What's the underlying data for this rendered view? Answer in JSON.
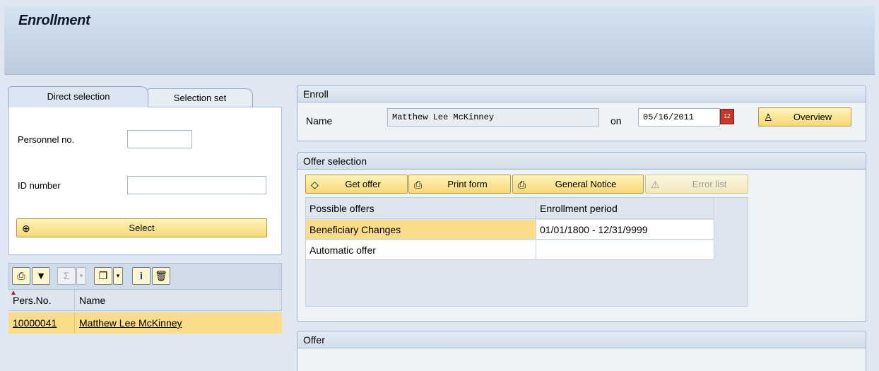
{
  "window": {
    "title": "Enrollment"
  },
  "left": {
    "tabs": [
      {
        "label": "Direct selection",
        "active": true
      },
      {
        "label": "Selection set",
        "active": false
      }
    ],
    "personnel_no": {
      "label": "Personnel no.",
      "value": ""
    },
    "id_number": {
      "label": "ID number",
      "value": ""
    },
    "select_button": "Select",
    "alv_toolbar_icons": [
      "print-icon",
      "filter-icon",
      "sum-icon",
      "dropdown-icon",
      "layout-icon",
      "dropdown-icon",
      "info-icon",
      "delete-icon"
    ],
    "results": {
      "columns": [
        "Pers.No.",
        "Name"
      ],
      "rows": [
        {
          "pers_no": "10000041",
          "name": "Matthew Lee McKinney"
        }
      ]
    }
  },
  "enroll": {
    "title": "Enroll",
    "name_label": "Name",
    "name_value": "Matthew Lee McKinney",
    "on_label": "on",
    "date_value": "05/16/2011",
    "overview_button": "Overview"
  },
  "offer_selection": {
    "title": "Offer selection",
    "buttons": {
      "get_offer": "Get offer",
      "print_form": "Print form",
      "general_notice": "General Notice",
      "error_list": "Error list"
    },
    "columns": [
      "Possible offers",
      "Enrollment period"
    ],
    "rows": [
      {
        "offer": "Beneficiary Changes",
        "period": "01/01/1800 - 12/31/9999",
        "selected": true
      },
      {
        "offer": "Automatic offer",
        "period": "",
        "selected": false
      }
    ]
  },
  "offer": {
    "title": "Offer"
  },
  "colors": {
    "selection_row": "#fbdc8a",
    "button": "#f7d878",
    "header_bg": "#c6d6e8"
  }
}
